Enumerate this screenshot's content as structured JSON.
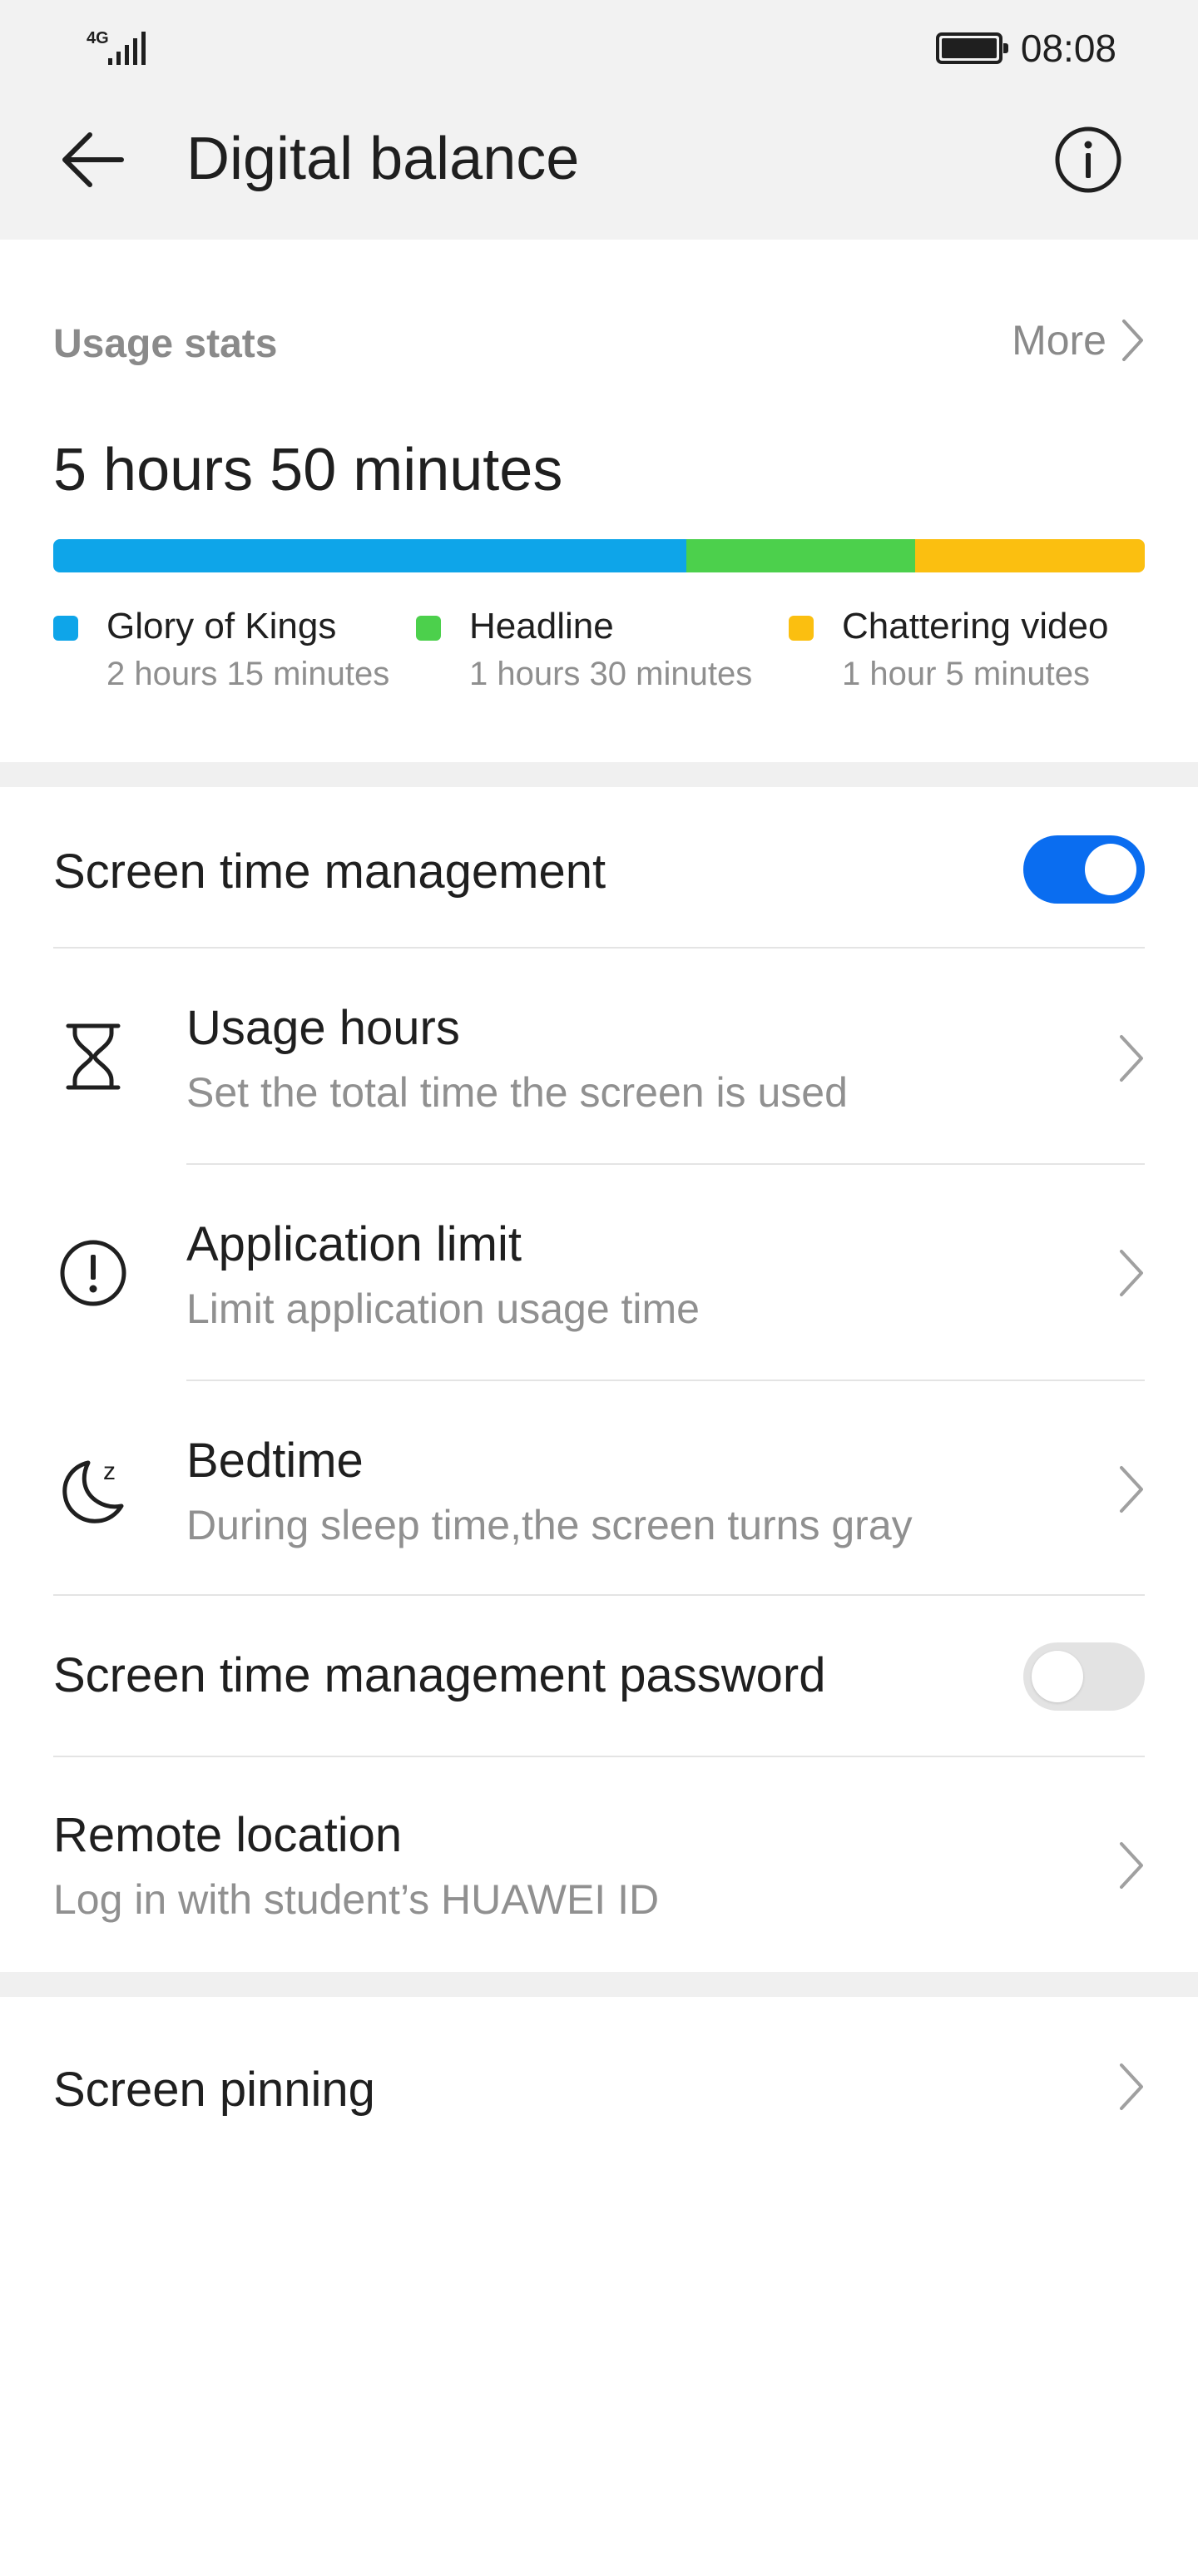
{
  "status_bar": {
    "network": "4G",
    "time": "08:08",
    "battery_icon": "battery-full-icon"
  },
  "header": {
    "title": "Digital balance",
    "back_icon": "arrow-left-icon",
    "info_icon": "info-circle-icon"
  },
  "usage": {
    "label": "Usage stats",
    "more": "More",
    "total": "5 hours 50 minutes",
    "apps": [
      {
        "name": "Glory of Kings",
        "time": "2 hours 15 minutes",
        "color": "#0ea5e9",
        "share": 0.58
      },
      {
        "name": "Headline",
        "time": "1 hours 30 minutes",
        "color": "#4cd04c",
        "share": 0.21
      },
      {
        "name": "Chattering video",
        "time": "1 hour 5 minutes",
        "color": "#fbbf10",
        "share": 0.21
      }
    ]
  },
  "settings": {
    "screen_time_management": {
      "label": "Screen time management",
      "enabled": true
    },
    "usage_hours": {
      "title": "Usage hours",
      "subtitle": "Set the total time the screen is used",
      "icon": "hourglass-icon"
    },
    "application_limit": {
      "title": "Application limit",
      "subtitle": "Limit application usage time",
      "icon": "exclamation-circle-icon"
    },
    "bedtime": {
      "title": "Bedtime",
      "subtitle": "During sleep time,the screen turns gray",
      "icon": "moon-sleep-icon"
    },
    "password": {
      "label": "Screen time management password",
      "enabled": false
    },
    "remote_location": {
      "title": "Remote location",
      "subtitle": "Log in with student’s HUAWEI ID"
    },
    "screen_pinning": {
      "title": "Screen pinning"
    }
  },
  "colors": {
    "toggle_on": "#0a6df0",
    "toggle_off": "#e3e3e3"
  }
}
